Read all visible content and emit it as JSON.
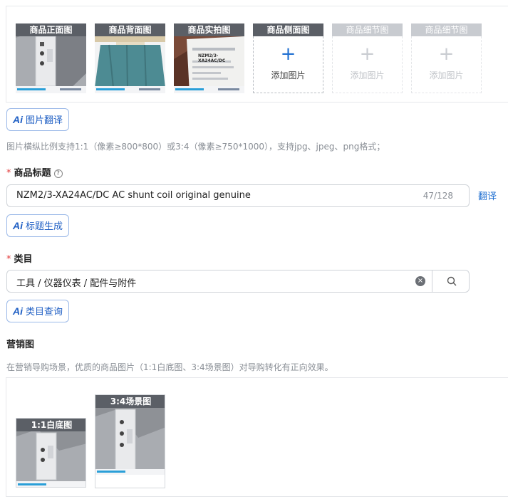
{
  "product_images": {
    "slots": [
      {
        "label": "商品正面图",
        "filled": true
      },
      {
        "label": "商品背面图",
        "filled": true
      },
      {
        "label": "商品实拍图",
        "filled": true
      },
      {
        "label": "商品侧面图",
        "filled": false,
        "add_text": "添加图片",
        "enabled": true
      },
      {
        "label": "商品细节图",
        "filled": false,
        "add_text": "添加图片",
        "enabled": false
      },
      {
        "label": "商品细节图",
        "filled": false,
        "add_text": "添加图片",
        "enabled": false
      }
    ],
    "label_shown_on_photo": "NZM2/3-XA24AC/DC"
  },
  "ai_translate_button": {
    "ai": "Ai",
    "label": "图片翻译"
  },
  "image_hint": "图片横纵比例支持1:1（像素≥800*800）或3:4（像素≥750*1000），支持jpg、jpeg、png格式；",
  "title_field": {
    "required_mark": "*",
    "label": "商品标题",
    "help_icon": "?",
    "value": "NZM2/3-XA24AC/DC AC shunt coil original genuine",
    "counter": "47/128",
    "translate_link": "翻译"
  },
  "ai_title_button": {
    "ai": "Ai",
    "label": "标题生成"
  },
  "category_field": {
    "required_mark": "*",
    "label": "类目",
    "value": "工具 / 仪器仪表 / 配件与附件",
    "clear_icon": "×"
  },
  "ai_category_button": {
    "ai": "Ai",
    "label": "类目查询"
  },
  "marketing": {
    "title": "营销图",
    "hint": "在营销导购场景，优质的商品图片（1:1白底图、3:4场景图）对导购转化有正向效果。",
    "slots": [
      {
        "label": "1:1白底图"
      },
      {
        "label": "3:4场景图"
      }
    ]
  },
  "colors": {
    "accent": "#1f6fd1",
    "required": "#e33b3b",
    "hint": "#8a8f96"
  }
}
